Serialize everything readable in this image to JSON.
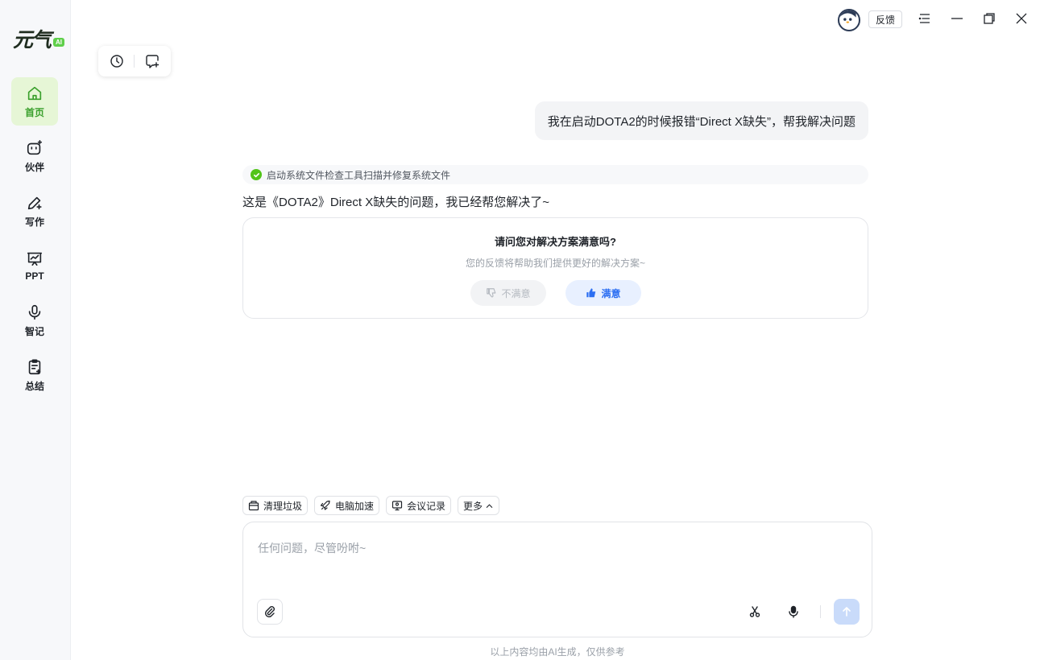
{
  "app": {
    "logo_text": "元气",
    "logo_badge": "AI"
  },
  "sidebar": {
    "items": [
      {
        "label": "首页",
        "icon": "home-icon",
        "active": true
      },
      {
        "label": "伙伴",
        "icon": "partner-icon",
        "active": false
      },
      {
        "label": "写作",
        "icon": "pen-icon",
        "active": false
      },
      {
        "label": "PPT",
        "icon": "presentation-icon",
        "active": false
      },
      {
        "label": "智记",
        "icon": "microphone-icon",
        "active": false
      },
      {
        "label": "总结",
        "icon": "clipboard-icon",
        "active": false
      }
    ]
  },
  "topbar": {
    "feedback_label": "反馈"
  },
  "chat": {
    "user_message": "我在启动DOTA2的时候报错“Direct X缺失”，帮我解决问题",
    "status_text": "启动系统文件检查工具扫描并修复系统文件",
    "answer_text": "这是《DOTA2》Direct X缺失的问题，我已经帮您解决了~",
    "survey": {
      "title": "请问您对解决方案满意吗?",
      "subtitle": "您的反馈将帮助我们提供更好的解决方案~",
      "dislike_label": "不满意",
      "like_label": "满意"
    }
  },
  "quick_actions": [
    {
      "label": "清理垃圾",
      "icon": "trash-icon"
    },
    {
      "label": "电脑加速",
      "icon": "rocket-icon"
    },
    {
      "label": "会议记录",
      "icon": "meeting-icon"
    },
    {
      "label": "更多",
      "icon": "chevron-up-icon"
    }
  ],
  "input": {
    "placeholder": "任何问题，尽管吩咐~"
  },
  "footer": {
    "disclaimer": "以上内容均由AI生成，仅供参考"
  },
  "colors": {
    "accent_green": "#3aa02c",
    "active_bg": "#e6f6d6",
    "like_blue": "#2b6ef2",
    "send_disabled": "#c9dbfa"
  }
}
